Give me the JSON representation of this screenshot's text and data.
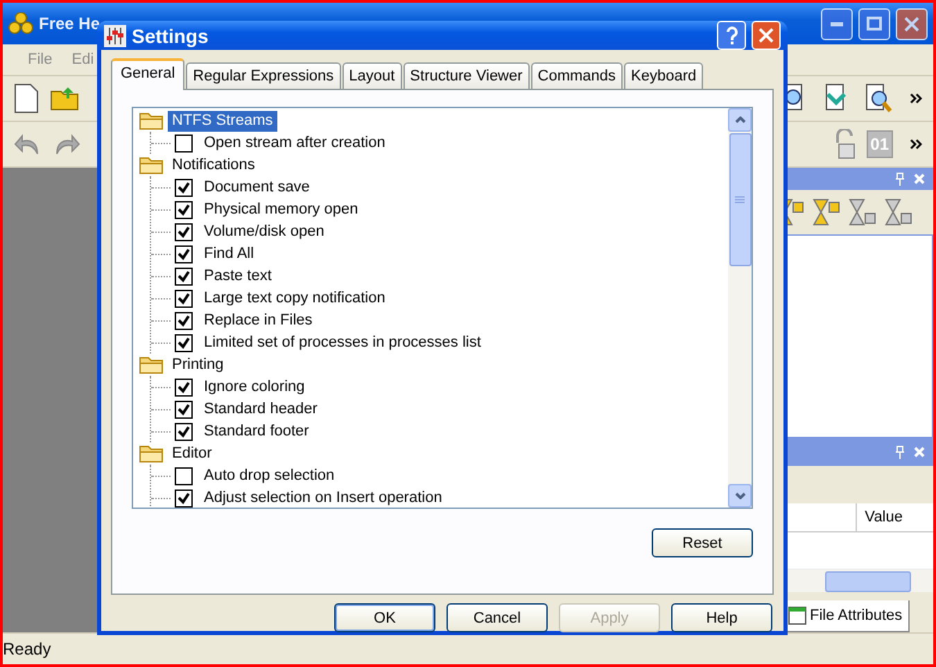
{
  "app": {
    "title": "Free He",
    "menu": [
      "File",
      "Edi"
    ],
    "toolbar_label": "01",
    "table": {
      "columns": [
        "Value"
      ]
    },
    "bottom_tab": "File Attributes",
    "status_bar": "Ready"
  },
  "dialog": {
    "title": "Settings",
    "tabs": [
      {
        "label": "General",
        "selected": true
      },
      {
        "label": "Regular Expressions",
        "selected": false
      },
      {
        "label": "Layout",
        "selected": false
      },
      {
        "label": "Structure Viewer",
        "selected": false
      },
      {
        "label": "Commands",
        "selected": false
      },
      {
        "label": "Keyboard",
        "selected": false
      }
    ],
    "tree": [
      {
        "label": "NTFS Streams",
        "selected": true,
        "children": [
          {
            "label": "Open stream after creation",
            "checked": false
          }
        ]
      },
      {
        "label": "Notifications",
        "selected": false,
        "children": [
          {
            "label": "Document save",
            "checked": true
          },
          {
            "label": "Physical memory open",
            "checked": true
          },
          {
            "label": "Volume/disk open",
            "checked": true
          },
          {
            "label": "Find All",
            "checked": true
          },
          {
            "label": "Paste text",
            "checked": true
          },
          {
            "label": "Large text copy notification",
            "checked": true
          },
          {
            "label": "Replace in Files",
            "checked": true
          },
          {
            "label": "Limited set of processes in processes list",
            "checked": true
          }
        ]
      },
      {
        "label": "Printing",
        "selected": false,
        "children": [
          {
            "label": "Ignore coloring",
            "checked": true
          },
          {
            "label": "Standard header",
            "checked": true
          },
          {
            "label": "Standard footer",
            "checked": true
          }
        ]
      },
      {
        "label": "Editor",
        "selected": false,
        "children": [
          {
            "label": "Auto drop selection",
            "checked": false
          },
          {
            "label": "Adjust selection on Insert operation",
            "checked": true
          }
        ]
      }
    ],
    "reset": "Reset",
    "buttons": [
      {
        "label": "OK",
        "disabled": false,
        "default": true
      },
      {
        "label": "Cancel",
        "disabled": false,
        "default": false
      },
      {
        "label": "Apply",
        "disabled": true,
        "default": false
      },
      {
        "label": "Help",
        "disabled": false,
        "default": false
      }
    ]
  }
}
